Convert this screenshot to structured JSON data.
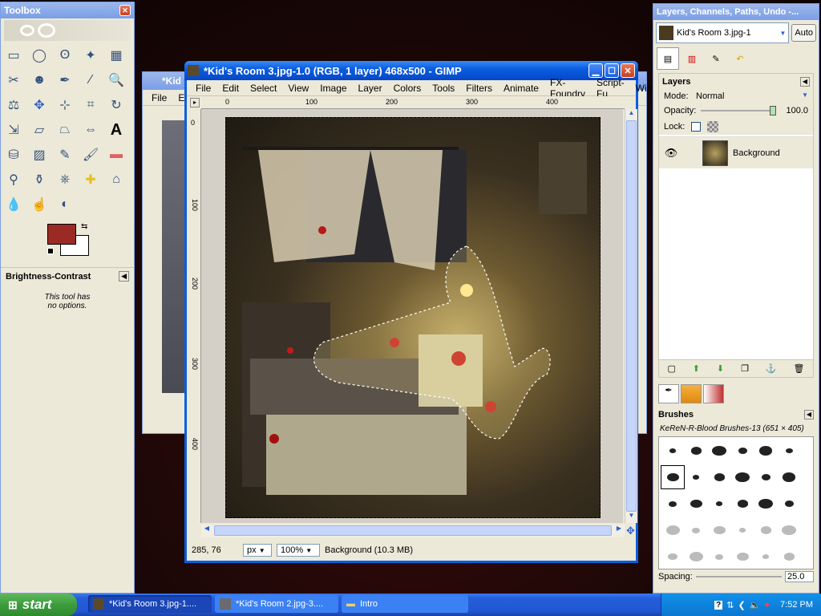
{
  "toolbox": {
    "title": "Toolbox",
    "active_tool": "Brightness-Contrast",
    "options_line1": "This tool has",
    "options_line2": "no options.",
    "fg_color": "#9c2a24",
    "bg_color": "#ffffff",
    "tools": [
      "rect-select-icon",
      "ellipse-select-icon",
      "lasso-icon",
      "fuzzy-select-icon",
      "select-by-color-icon",
      "scissors-icon",
      "foreground-select-icon",
      "paths-icon",
      "color-picker-icon",
      "zoom-icon",
      "measure-icon",
      "move-icon",
      "align-icon",
      "crop-icon",
      "rotate-icon",
      "scale-icon",
      "shear-icon",
      "perspective-icon",
      "flip-icon",
      "text-icon",
      "bucket-fill-icon",
      "blend-icon",
      "pencil-icon",
      "paintbrush-icon",
      "eraser-icon",
      "airbrush-icon",
      "ink-icon",
      "clone-icon",
      "heal-icon",
      "perspective-clone-icon",
      "blur-icon",
      "smudge-icon",
      "dodge-icon"
    ]
  },
  "back_window": {
    "title": "*Kid",
    "menu_file": "File",
    "menu_edit": "Ed"
  },
  "image_window": {
    "title": "*Kid's Room 3.jpg-1.0 (RGB, 1 layer) 468x500 - GIMP",
    "menus": [
      "File",
      "Edit",
      "Select",
      "View",
      "Image",
      "Layer",
      "Colors",
      "Tools",
      "Filters",
      "Animate",
      "FX-Foundry",
      "Script-Fu",
      "Windo"
    ],
    "ruler_h": [
      "0",
      "100",
      "200",
      "300",
      "400"
    ],
    "ruler_v": [
      "0",
      "100",
      "200",
      "300",
      "400"
    ],
    "coords": "285, 76",
    "unit": "px",
    "zoom": "100%",
    "status": "Background (10.3 MB)"
  },
  "layers_dock": {
    "title": "Layers, Channels, Paths, Undo -...",
    "image_select": "Kid's Room 3.jpg-1",
    "auto_button": "Auto",
    "section_title": "Layers",
    "mode_label": "Mode:",
    "mode_value": "Normal",
    "opacity_label": "Opacity:",
    "opacity_value": "100.0",
    "opacity_fraction": 1.0,
    "lock_label": "Lock:",
    "layers": [
      {
        "name": "Background",
        "visible": true
      }
    ],
    "brushes_title": "Brushes",
    "brush_name": "KeReN-R-Blood Brushes-13 (651 × 405)",
    "spacing_label": "Spacing:",
    "spacing_value": "25.0"
  },
  "taskbar": {
    "start_label": "start",
    "items": [
      {
        "label": "*Kid's Room 3.jpg-1....",
        "active": true
      },
      {
        "label": "*Kid's Room 2.jpg-3....",
        "active": false
      },
      {
        "label": "Intro",
        "active": false
      }
    ],
    "clock": "7:52 PM"
  },
  "colors": {
    "xp_blue": "#0a5ee0",
    "taskbar": "#245edb",
    "start_green": "#3c9c3c"
  }
}
